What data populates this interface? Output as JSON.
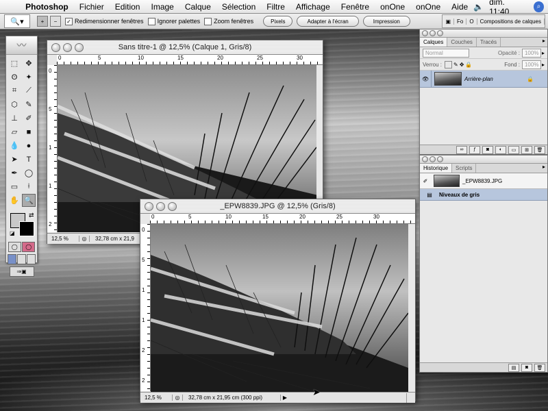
{
  "menubar": {
    "app": "Photoshop",
    "items": [
      "Fichier",
      "Edition",
      "Image",
      "Calque",
      "Sélection",
      "Filtre",
      "Affichage",
      "Fenêtre",
      "onOne",
      "onOne",
      "Aide"
    ],
    "clock": "dim. 11:40"
  },
  "options": {
    "resize_label": "Redimensionner fenêtres",
    "ignore_palettes_label": "Ignorer palettes",
    "zoom_windows_label": "Zoom fenêtres",
    "pixels_button": "Pixels",
    "fit_screen_button": "Adapter à l'écran",
    "print_button": "Impression",
    "well_tabs": [
      "Fo",
      "O",
      "Compositions de calques"
    ]
  },
  "windows": {
    "doc1": {
      "title": "Sans titre-1 @ 12,5% (Calque 1, Gris/8)",
      "zoom": "12,5 %",
      "info": "32,78 cm x 21,9",
      "ruler_h": [
        "0",
        "5",
        "10",
        "15",
        "20",
        "25",
        "30"
      ],
      "ruler_v": [
        "0",
        "5",
        "1",
        "1",
        "2"
      ]
    },
    "doc2": {
      "title": "_EPW8839.JPG @ 12,5% (Gris/8)",
      "zoom": "12,5 %",
      "info": "32,78 cm x 21,95 cm (300 ppi)",
      "ruler_h": [
        "0",
        "5",
        "10",
        "15",
        "20",
        "25",
        "30"
      ],
      "ruler_v": [
        "0",
        "5",
        "1",
        "1",
        "2",
        "2"
      ]
    }
  },
  "layers_panel": {
    "tabs": [
      "Calques",
      "Couches",
      "Tracés"
    ],
    "blend_mode": "Normal",
    "opacity_label": "Opacité :",
    "opacity_value": "100%",
    "lock_label": "Verrou :",
    "fill_label": "Fond :",
    "fill_value": "100%",
    "layer_name": "Arrière-plan"
  },
  "history_panel": {
    "tabs": [
      "Historique",
      "Scripts"
    ],
    "snapshot": "_EPW8839.JPG",
    "step": "Niveaux de gris"
  },
  "colors": {
    "selection": "#b7c6dd",
    "accent": "#3a6fd0"
  }
}
